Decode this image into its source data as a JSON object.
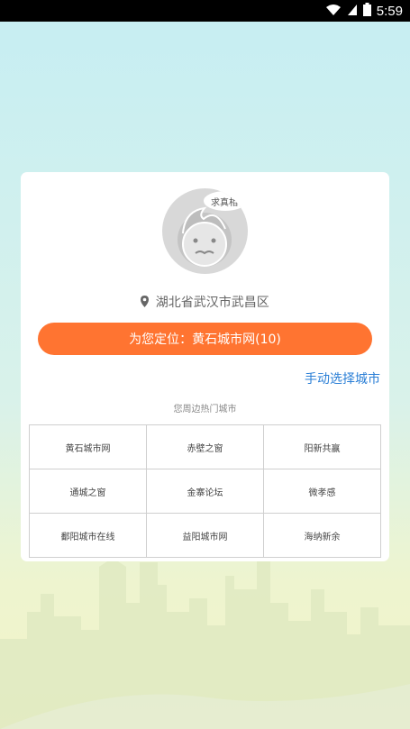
{
  "status_bar": {
    "time": "5:59",
    "icons": [
      "wifi-icon",
      "cell-signal-icon",
      "battery-icon"
    ]
  },
  "location": {
    "icon": "location-pin-icon",
    "text": "湖北省武汉市武昌区"
  },
  "avatar": {
    "badge_text": "求真相"
  },
  "locate_button": {
    "label": "为您定位：黄石城市网(10)"
  },
  "manual_select": {
    "label": "手动选择城市"
  },
  "hot_cities": {
    "title": "您周边热门城市",
    "rows": [
      [
        "黄石城市网",
        "赤壁之窗",
        "阳新共赢"
      ],
      [
        "通城之窗",
        "金寨论坛",
        "微孝感"
      ],
      [
        "鄱阳城市在线",
        "益阳城市网",
        "海纳新余"
      ]
    ]
  },
  "colors": {
    "accent": "#ff7431",
    "link": "#2b7fd6"
  }
}
